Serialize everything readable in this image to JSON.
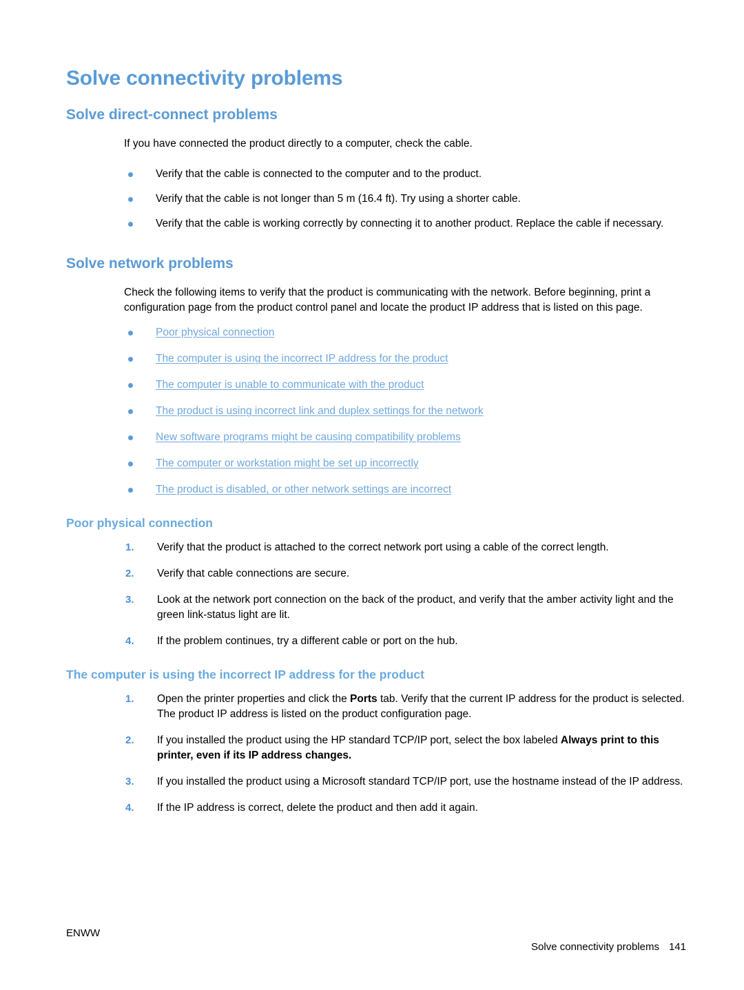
{
  "page": {
    "title": "Solve connectivity problems",
    "accent_blue": "#5b9bd5",
    "link_blue": "#6fa8dc",
    "number_blue": "#4a90d9"
  },
  "direct_connect": {
    "heading": "Solve direct-connect problems",
    "intro": "If you have connected the product directly to a computer, check the cable.",
    "bullets": [
      "Verify that the cable is connected to the computer and to the product.",
      "Verify that the cable is not longer than 5 m (16.4 ft). Try using a shorter cable.",
      "Verify that the cable is working correctly by connecting it to another product. Replace the cable if necessary."
    ]
  },
  "network": {
    "heading": "Solve network problems",
    "intro": "Check the following items to verify that the product is communicating with the network. Before beginning, print a configuration page from the product control panel and locate the product IP address that is listed on this page.",
    "links": [
      "Poor physical connection",
      "The computer is using the incorrect IP address for the product",
      "The computer is unable to communicate with the product",
      "The product is using incorrect link and duplex settings for the network",
      "New software programs might be causing compatibility problems",
      "The computer or workstation might be set up incorrectly",
      "The product is disabled, or other network settings are incorrect"
    ]
  },
  "poor_physical_connection": {
    "heading": "Poor physical connection",
    "steps": [
      {
        "num": "1.",
        "text": "Verify that the product is attached to the correct network port using a cable of the correct length."
      },
      {
        "num": "2.",
        "text": "Verify that cable connections are secure."
      },
      {
        "num": "3.",
        "text": "Look at the network port connection on the back of the product, and verify that the amber activity light and the green link-status light are lit."
      },
      {
        "num": "4.",
        "text": "If the problem continues, try a different cable or port on the hub."
      }
    ]
  },
  "incorrect_ip": {
    "heading": "The computer is using the incorrect IP address for the product",
    "steps": [
      {
        "num": "1.",
        "pre": "Open the printer properties and click the ",
        "bold": "Ports",
        "post": " tab. Verify that the current IP address for the product is selected. The product IP address is listed on the product configuration page."
      },
      {
        "num": "2.",
        "pre": "If you installed the product using the HP standard TCP/IP port, select the box labeled ",
        "bold": "Always print to this printer, even if its IP address changes.",
        "post": ""
      },
      {
        "num": "3.",
        "pre": "If you installed the product using a Microsoft standard TCP/IP port, use the hostname instead of the IP address.",
        "bold": "",
        "post": ""
      },
      {
        "num": "4.",
        "pre": "If the IP address is correct, delete the product and then add it again.",
        "bold": "",
        "post": ""
      }
    ]
  },
  "footer": {
    "left": "ENWW",
    "right_title": "Solve connectivity problems",
    "page_number": "141"
  }
}
